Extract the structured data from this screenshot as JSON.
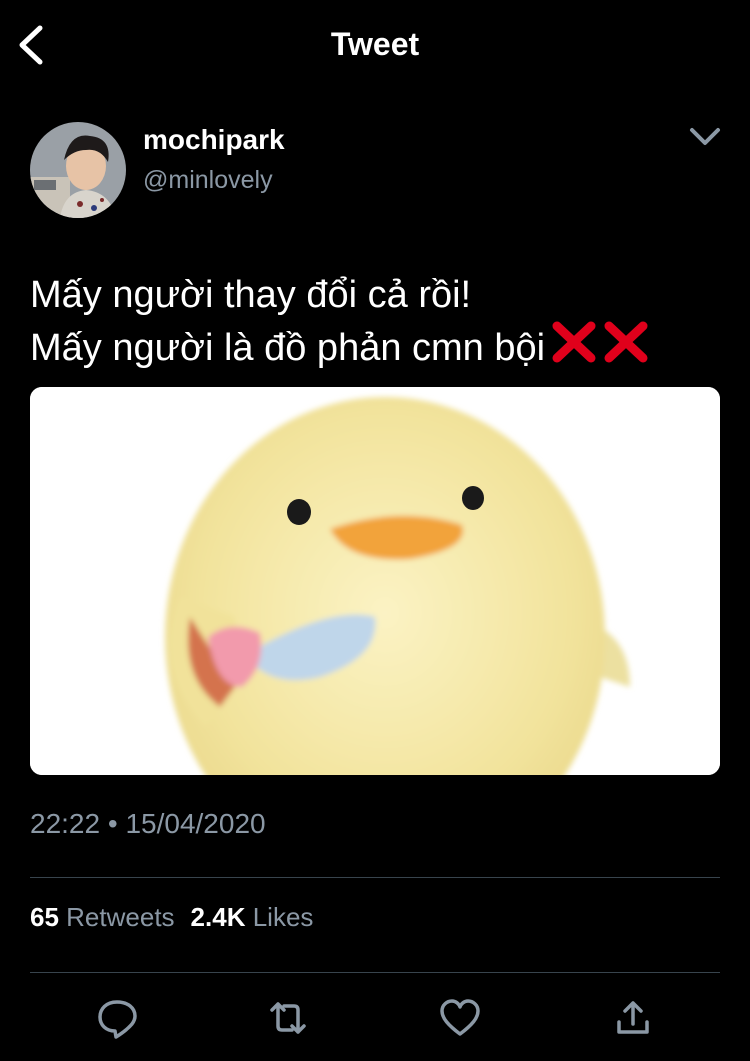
{
  "header": {
    "title": "Tweet",
    "back_icon": "chevron-left-icon"
  },
  "author": {
    "name": "mochipark",
    "handle": "@minlovely",
    "more_icon": "chevron-down-icon"
  },
  "tweet": {
    "lines": [
      "Mấy người thay đổi cả rồi!",
      "Mấy người là đồ phản cmn bội"
    ],
    "emoji": "cross-mark-icon x2",
    "media_alt": "yellow plush chick holding a knife"
  },
  "meta": {
    "time": "22:22",
    "separator": "•",
    "date": "15/04/2020"
  },
  "stats": {
    "retweets_count": "65",
    "retweets_label": "Retweets",
    "likes_count": "2.4K",
    "likes_label": "Likes"
  },
  "actions": [
    "reply-icon",
    "retweet-icon",
    "like-icon",
    "share-icon"
  ],
  "colors": {
    "background": "#000000",
    "secondary_text": "#8b98a5",
    "divider": "#38444d",
    "cross": "#e0001b"
  }
}
